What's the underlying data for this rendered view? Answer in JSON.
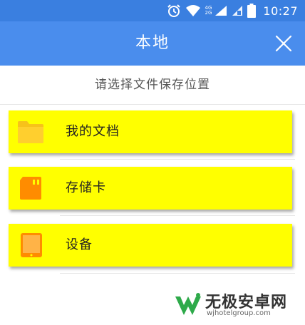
{
  "status_bar": {
    "time": "10:27",
    "network_top": "4G",
    "network_bottom": "2G",
    "icons": [
      "alarm-icon",
      "wifi-icon",
      "signal-icon",
      "sim-icon",
      "battery-icon"
    ]
  },
  "app_bar": {
    "title": "本地",
    "close_icon": "close-icon",
    "background": "#4a8ded"
  },
  "subtitle": "请选择文件保存位置",
  "options": [
    {
      "label": "我的文档",
      "icon": "folder-icon"
    },
    {
      "label": "存储卡",
      "icon": "sd-card-icon"
    },
    {
      "label": "设备",
      "icon": "tablet-device-icon"
    }
  ],
  "highlight_color": "#ffff00",
  "watermark": {
    "title": "无极安卓网",
    "url": "wjhotelgroup.com"
  }
}
